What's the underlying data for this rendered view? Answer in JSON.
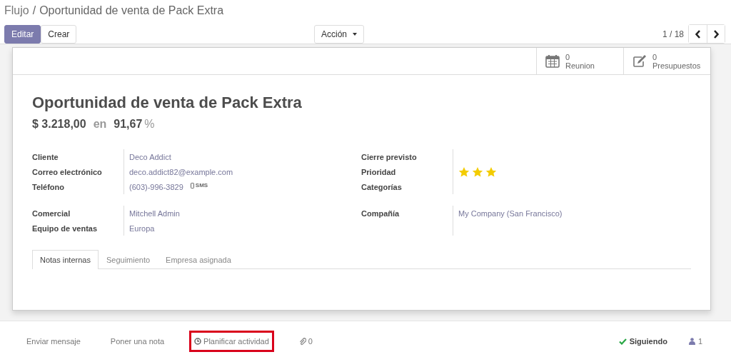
{
  "breadcrumb": {
    "parent": "Flujo",
    "separator": "/",
    "current": "Oportunidad de venta de Pack Extra"
  },
  "buttons": {
    "edit": "Editar",
    "create": "Crear",
    "action": "Acción"
  },
  "pager": {
    "value": "1 / 18"
  },
  "stat_buttons": [
    {
      "count": "0",
      "label": "Reunion"
    },
    {
      "count": "0",
      "label": "Presupuestos"
    }
  ],
  "title": "Oportunidad de venta de Pack Extra",
  "amount": {
    "revenue": "$ 3.218,00",
    "connector": "en",
    "probability": "91,67",
    "unit": "%"
  },
  "field_groups": [
    {
      "left": [
        {
          "kind": "text",
          "label": "Cliente",
          "value": "Deco Addict"
        },
        {
          "kind": "text",
          "label": "Correo electrónico",
          "value": "deco.addict82@example.com"
        },
        {
          "kind": "phone",
          "label": "Teléfono",
          "value": "(603)-996-3829",
          "action": "SMS"
        }
      ],
      "right": [
        {
          "kind": "empty",
          "label": "Cierre previsto"
        },
        {
          "kind": "stars",
          "label": "Prioridad",
          "stars": 3
        },
        {
          "kind": "empty",
          "label": "Categorías"
        }
      ]
    },
    {
      "left": [
        {
          "kind": "text",
          "label": "Comercial",
          "value": "Mitchell Admin"
        },
        {
          "kind": "text",
          "label": "Equipo de ventas",
          "value": "Europa"
        }
      ],
      "right": [
        {
          "kind": "text",
          "label": "Compañía",
          "value": "My Company (San Francisco)"
        }
      ]
    }
  ],
  "tabs": [
    {
      "label": "Notas internas",
      "selected": true
    },
    {
      "label": "Seguimiento",
      "selected": false
    },
    {
      "label": "Empresa asignada",
      "selected": false
    }
  ],
  "chatter": {
    "actions": [
      {
        "label": "Enviar mensaje",
        "kind": "plain",
        "highlighted": false
      },
      {
        "label": "Poner una nota",
        "kind": "plain",
        "highlighted": false
      },
      {
        "label": "Planificar actividad",
        "kind": "activity",
        "highlighted": true
      },
      {
        "label": "0",
        "kind": "attachment",
        "highlighted": false
      }
    ],
    "follow": "Siguiendo",
    "followers": "1"
  }
}
